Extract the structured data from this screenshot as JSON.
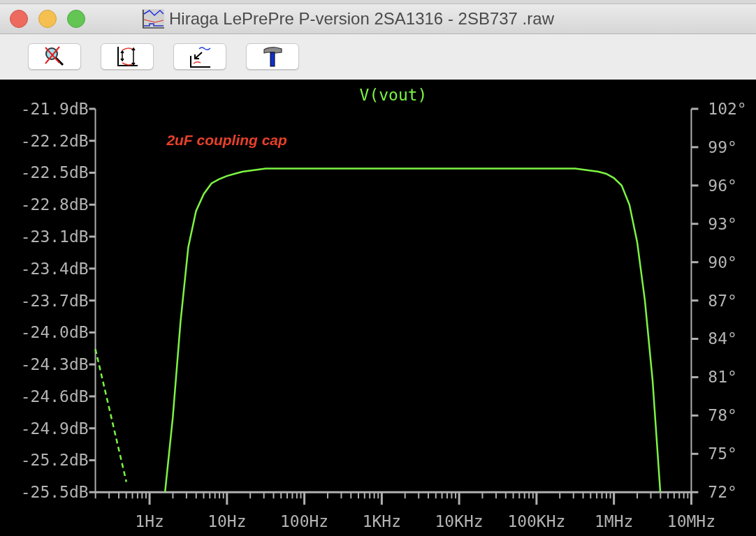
{
  "window": {
    "title": "Hiraga LePrePre P-version 2SA1316 - 2SB737 .raw"
  },
  "plot": {
    "chart_data": {
      "type": "line",
      "title": "V(vout)",
      "categories": [
        null,
        null,
        null,
        null,
        null,
        null,
        null,
        "1Hz",
        null,
        null,
        null,
        null,
        null,
        null,
        null,
        null,
        null,
        "10Hz",
        null,
        null,
        null,
        null,
        null,
        null,
        null,
        null,
        null,
        "100Hz",
        null,
        null,
        null,
        null,
        null,
        null,
        null,
        null,
        null,
        "1KHz",
        null,
        null,
        null,
        null,
        null,
        null,
        null,
        null,
        null,
        "10KHz",
        null,
        null,
        null,
        null,
        null,
        null,
        null,
        null,
        null,
        "100KHz",
        null,
        null,
        null,
        null,
        null,
        null,
        null,
        null,
        null,
        "1MHz",
        null,
        null,
        null,
        null,
        null,
        null,
        null,
        null,
        null,
        "10MHz"
      ],
      "ylim": [
        -25.5,
        -21.9
      ],
      "yticks": [
        {
          "value": -21.9,
          "label": "-21.9dB"
        },
        {
          "value": -22.2,
          "label": "-22.2dB"
        },
        {
          "value": -22.5,
          "label": "-22.5dB"
        },
        {
          "value": -22.8,
          "label": "-22.8dB"
        },
        {
          "value": -23.1,
          "label": "-23.1dB"
        },
        {
          "value": -23.4,
          "label": "-23.4dB"
        },
        {
          "value": -23.7,
          "label": "-23.7dB"
        },
        {
          "value": -24.0,
          "label": "-24.0dB"
        },
        {
          "value": -24.3,
          "label": "-24.3dB"
        },
        {
          "value": -24.6,
          "label": "-24.6dB"
        },
        {
          "value": -24.9,
          "label": "-24.9dB"
        },
        {
          "value": -25.2,
          "label": "-25.2dB"
        },
        {
          "value": -25.5,
          "label": "-25.5dB"
        }
      ],
      "y2lim": [
        72,
        102
      ],
      "y2ticks": [
        {
          "value": 102,
          "label": "102°"
        },
        {
          "value": 99,
          "label": "99°"
        },
        {
          "value": 96,
          "label": "96°"
        },
        {
          "value": 93,
          "label": "93°"
        },
        {
          "value": 90,
          "label": "90°"
        },
        {
          "value": 87,
          "label": "87°"
        },
        {
          "value": 84,
          "label": "84°"
        },
        {
          "value": 81,
          "label": "81°"
        },
        {
          "value": 78,
          "label": "78°"
        },
        {
          "value": 75,
          "label": "75°"
        },
        {
          "value": 72,
          "label": "72°"
        }
      ],
      "series": [
        {
          "color": "#7cf542",
          "values": [
            null,
            null,
            null,
            null,
            null,
            null,
            null,
            null,
            null,
            -25.5,
            -24.8,
            -23.9,
            -23.2,
            -22.86,
            -22.7,
            -22.6,
            -22.56,
            -22.53,
            -22.51,
            -22.49,
            -22.48,
            -22.47,
            -22.46,
            -22.46,
            -22.46,
            -22.46,
            -22.46,
            -22.46,
            -22.46,
            -22.46,
            -22.46,
            -22.46,
            -22.46,
            -22.46,
            -22.46,
            -22.46,
            -22.46,
            -22.46,
            -22.46,
            -22.46,
            -22.46,
            -22.46,
            -22.46,
            -22.46,
            -22.46,
            -22.46,
            -22.46,
            -22.46,
            -22.46,
            -22.46,
            -22.46,
            -22.46,
            -22.46,
            -22.46,
            -22.46,
            -22.46,
            -22.46,
            -22.46,
            -22.46,
            -22.46,
            -22.46,
            -22.46,
            -22.46,
            -22.47,
            -22.48,
            -22.49,
            -22.51,
            -22.55,
            -22.62,
            -22.8,
            -23.15,
            -23.7,
            -24.45,
            -25.5,
            null,
            null,
            null,
            null
          ]
        },
        {
          "color": "#7cf542",
          "axis": "y2",
          "line_style": "dashed",
          "values": [
            83.2,
            80.6,
            78.0,
            75.4,
            72.8,
            null,
            null,
            null,
            null,
            null,
            null,
            null,
            null,
            null,
            null,
            null,
            null,
            null,
            null,
            null,
            null,
            null,
            null,
            null,
            null,
            null,
            null,
            null,
            null,
            null,
            null,
            null,
            null,
            null,
            null,
            null,
            null,
            null,
            null,
            null,
            null,
            null,
            null,
            null,
            null,
            null,
            null,
            null,
            null,
            null,
            null,
            null,
            null,
            null,
            null,
            null,
            null,
            null,
            null,
            null,
            null,
            null,
            null,
            null,
            null,
            null,
            null,
            null,
            null,
            null,
            null,
            null,
            null,
            null,
            null,
            null,
            null,
            null
          ]
        }
      ],
      "annotations": [
        "2uF coupling cap"
      ]
    }
  }
}
